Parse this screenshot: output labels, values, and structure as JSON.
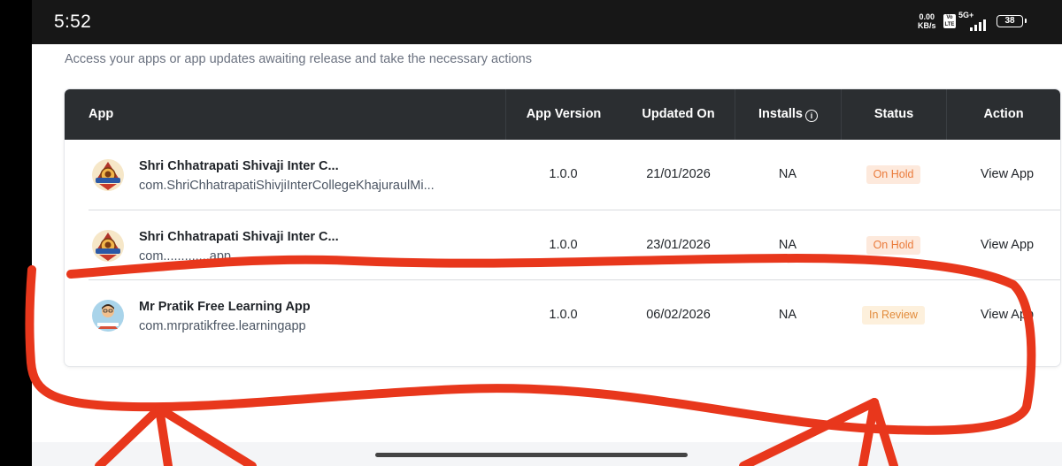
{
  "status_bar": {
    "time": "5:52",
    "net_speed_value": "0.00",
    "net_speed_unit": "KB/s",
    "volte": "Vo LTE",
    "network_type": "5G+",
    "battery": "38"
  },
  "page": {
    "subtitle": "Access your apps or app updates awaiting release and take the necessary actions"
  },
  "table": {
    "headers": {
      "app": "App",
      "version": "App Version",
      "updated": "Updated On",
      "installs": "Installs",
      "status": "Status",
      "action": "Action"
    },
    "rows": [
      {
        "name": "Shri Chhatrapati Shivaji Inter C...",
        "package": "com.ShriChhatrapatiShivjiInterCollegeKhajuraulMi...",
        "version": "1.0.0",
        "updated": "21/01/2026",
        "installs": "NA",
        "status": "On Hold",
        "action": "View App",
        "logo": "school-crest-icon"
      },
      {
        "name": "Shri Chhatrapati Shivaji Inter C...",
        "package": "com.............app",
        "version": "1.0.0",
        "updated": "23/01/2026",
        "installs": "NA",
        "status": "On Hold",
        "action": "View App",
        "logo": "school-crest-icon"
      },
      {
        "name": "Mr Pratik Free Learning App",
        "package": "com.mrpratikfree.learningapp",
        "version": "1.0.0",
        "updated": "06/02/2026",
        "installs": "NA",
        "status": "In Review",
        "action": "View App",
        "logo": "teacher-avatar-icon"
      }
    ]
  },
  "colors": {
    "header_bg": "#2b2e31",
    "on_hold_bg": "#fde9dc",
    "on_hold_text": "#ea7a3a",
    "in_review_bg": "#fdf0dc",
    "in_review_text": "#e28b3b",
    "annotation": "#e8371c"
  }
}
